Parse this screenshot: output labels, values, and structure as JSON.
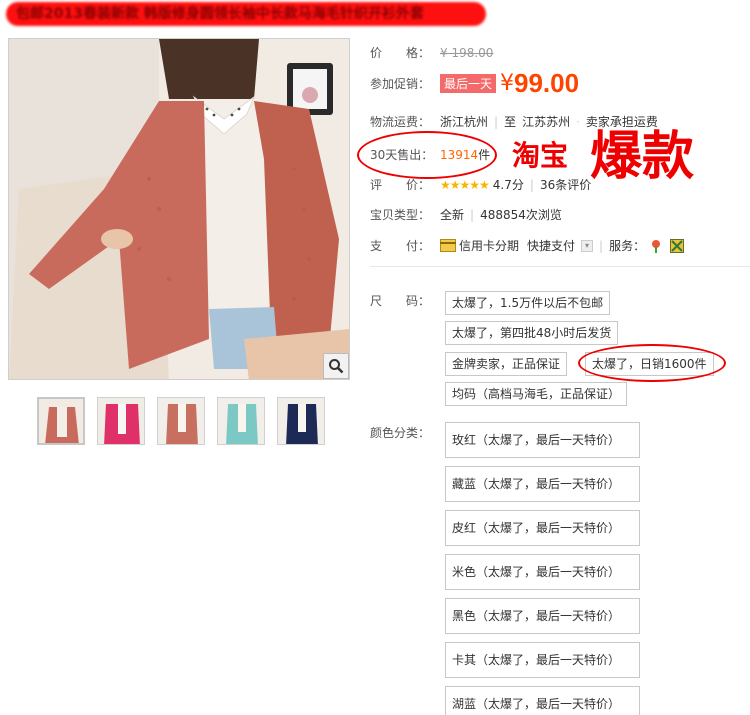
{
  "title_bar": {
    "text": "包邮2013春装新款 韩版修身圆领长袖中长款马海毛针织开衫外套"
  },
  "gallery": {
    "zoom_icon": "magnifier-icon",
    "thumbnail_count": 5
  },
  "info": {
    "price": {
      "label": "价　　格：",
      "original": "¥ 198.00"
    },
    "promotion": {
      "label": "参加促销：",
      "badge": "最后一天",
      "currency": "¥",
      "amount": "99.00"
    },
    "shipping": {
      "label": "物流运费：",
      "from": "浙江杭州",
      "to_prefix": "至",
      "to": "江苏苏州",
      "extra": "卖家承担运费"
    },
    "sales": {
      "label": "30天售出：",
      "count": "13914",
      "unit": "件"
    },
    "rating": {
      "label": "评　　价：",
      "stars": "★★★★★",
      "score": "4.7分",
      "reviews": "36条评价"
    },
    "item_type": {
      "label": "宝贝类型：",
      "condition": "全新",
      "views": "488854次浏览"
    },
    "payment": {
      "label": "支　　付：",
      "installment": "信用卡分期",
      "quick_pay": "快捷支付",
      "service_label": "服务："
    }
  },
  "overlay": {
    "small": "淘宝",
    "big": "爆款"
  },
  "size": {
    "label": "尺　　码：",
    "options": [
      "太爆了，1.5万件以后不包邮",
      "太爆了，第四批48小时后发货",
      "金牌卖家，正品保证",
      "太爆了，日销1600件",
      "均码（高档马海毛，正品保证）"
    ]
  },
  "color": {
    "label": "颜色分类：",
    "options": [
      "玫红（太爆了，最后一天特价）",
      "藏蓝（太爆了，最后一天特价）",
      "皮红（太爆了，最后一天特价）",
      "米色（太爆了，最后一天特价）",
      "黑色（太爆了，最后一天特价）",
      "卡其（太爆了，最后一天特价）",
      "湖蓝（太爆了，最后一天特价）"
    ]
  },
  "colors": {
    "accent": "#ff4400",
    "badge": "#f46a6a",
    "annotation": "#ee0000",
    "star": "#f8b500"
  }
}
